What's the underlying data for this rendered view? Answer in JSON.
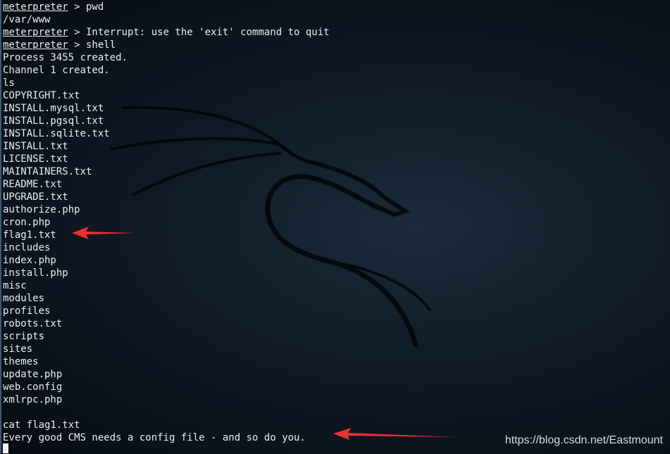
{
  "terminal": {
    "lines": [
      {
        "prompt": "meterpreter",
        "text": " > pwd"
      },
      {
        "prompt": "",
        "text": "/var/www"
      },
      {
        "prompt": "meterpreter",
        "text": " > Interrupt: use the 'exit' command to quit"
      },
      {
        "prompt": "meterpreter",
        "text": " > shell"
      },
      {
        "prompt": "",
        "text": "Process 3455 created."
      },
      {
        "prompt": "",
        "text": "Channel 1 created."
      },
      {
        "prompt": "",
        "text": "ls"
      },
      {
        "prompt": "",
        "text": "COPYRIGHT.txt"
      },
      {
        "prompt": "",
        "text": "INSTALL.mysql.txt"
      },
      {
        "prompt": "",
        "text": "INSTALL.pgsql.txt"
      },
      {
        "prompt": "",
        "text": "INSTALL.sqlite.txt"
      },
      {
        "prompt": "",
        "text": "INSTALL.txt"
      },
      {
        "prompt": "",
        "text": "LICENSE.txt"
      },
      {
        "prompt": "",
        "text": "MAINTAINERS.txt"
      },
      {
        "prompt": "",
        "text": "README.txt"
      },
      {
        "prompt": "",
        "text": "UPGRADE.txt"
      },
      {
        "prompt": "",
        "text": "authorize.php"
      },
      {
        "prompt": "",
        "text": "cron.php"
      },
      {
        "prompt": "",
        "text": "flag1.txt"
      },
      {
        "prompt": "",
        "text": "includes"
      },
      {
        "prompt": "",
        "text": "index.php"
      },
      {
        "prompt": "",
        "text": "install.php"
      },
      {
        "prompt": "",
        "text": "misc"
      },
      {
        "prompt": "",
        "text": "modules"
      },
      {
        "prompt": "",
        "text": "profiles"
      },
      {
        "prompt": "",
        "text": "robots.txt"
      },
      {
        "prompt": "",
        "text": "scripts"
      },
      {
        "prompt": "",
        "text": "sites"
      },
      {
        "prompt": "",
        "text": "themes"
      },
      {
        "prompt": "",
        "text": "update.php"
      },
      {
        "prompt": "",
        "text": "web.config"
      },
      {
        "prompt": "",
        "text": "xmlrpc.php"
      },
      {
        "prompt": "",
        "text": ""
      },
      {
        "prompt": "",
        "text": "cat flag1.txt"
      },
      {
        "prompt": "",
        "text": "Every good CMS needs a config file - and so do you."
      }
    ]
  },
  "colors": {
    "text": "#e9eef3",
    "arrow": "#e8332f",
    "background": "#0f1a26"
  },
  "icons": [
    "kali-dragon-logo",
    "red-arrow-annotation"
  ],
  "watermark": "https://blog.csdn.net/Eastmount"
}
